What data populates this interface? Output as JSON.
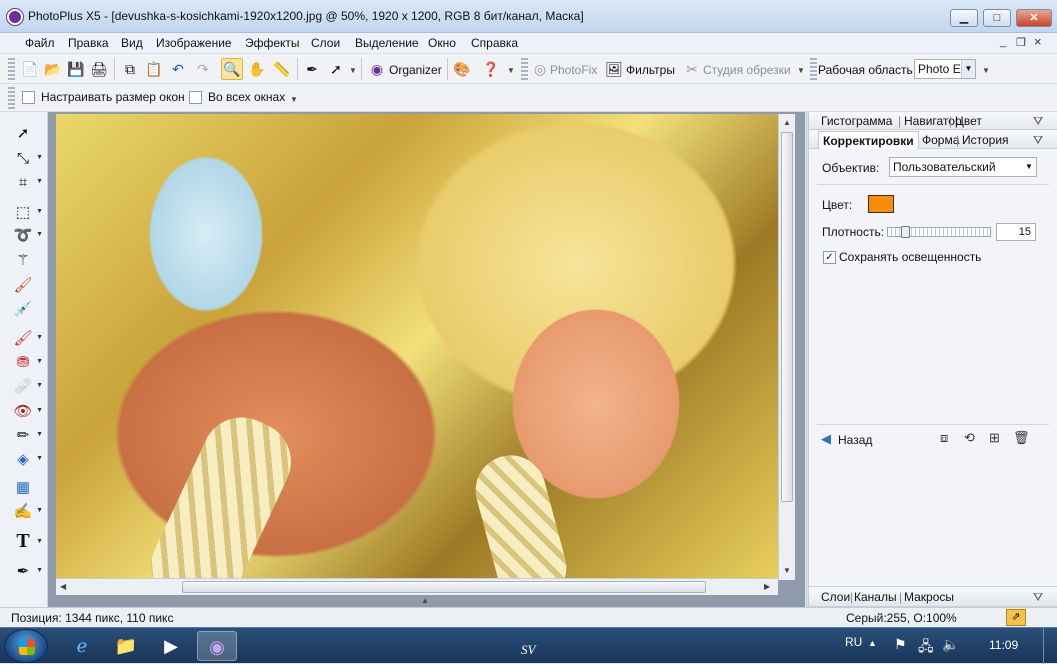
{
  "window": {
    "title": "PhotoPlus X5 - [devushka-s-kosichkami-1920x1200.jpg @ 50%, 1920 x 1200, RGB 8 бит/канал, Маска]",
    "min_symbol": "▁",
    "max_symbol": "□",
    "close_symbol": "✕"
  },
  "menu": {
    "items": [
      "Файл",
      "Правка",
      "Вид",
      "Изображение",
      "Эффекты",
      "Слои",
      "Выделение",
      "Окно",
      "Справка"
    ],
    "mdi_min": "_",
    "mdi_restore": "❐",
    "mdi_close": "×"
  },
  "toolbar": {
    "organizer_label": "Organizer",
    "photofix_label": "PhotoFix",
    "filters_label": "Фильтры",
    "crop_studio_label": "Студия обрезки",
    "workspace_label": "Рабочая область",
    "workspace_value": "Photo Ec"
  },
  "context_toolbar": {
    "resize_windows_label": "Настраивать размер окон",
    "all_windows_label": "Во всех окнах",
    "resize_windows_checked": false,
    "all_windows_checked": false
  },
  "panels": {
    "top_tabs": [
      "Гистограмма",
      "Навигатор",
      "Цвет"
    ],
    "mid_tabs": [
      "Корректировки",
      "Форма",
      "История"
    ],
    "bottom_tabs": [
      "Слои",
      "Каналы",
      "Макросы"
    ],
    "lens_label": "Объектив:",
    "lens_value": "Пользовательский",
    "color_label": "Цвет:",
    "color_value": "#f78c0b",
    "density_label": "Плотность:",
    "density_value": "15",
    "density_fraction": 0.15,
    "preserve_label": "Сохранять освещенность",
    "preserve_checked": true,
    "back_label": "Назад"
  },
  "status": {
    "position": "Позиция: 1344 пикс, 110 пикс",
    "info": "Серый:255, О:100%"
  },
  "taskbar": {
    "lang": "RU",
    "time": "11:09",
    "bottom_text": "SV"
  }
}
